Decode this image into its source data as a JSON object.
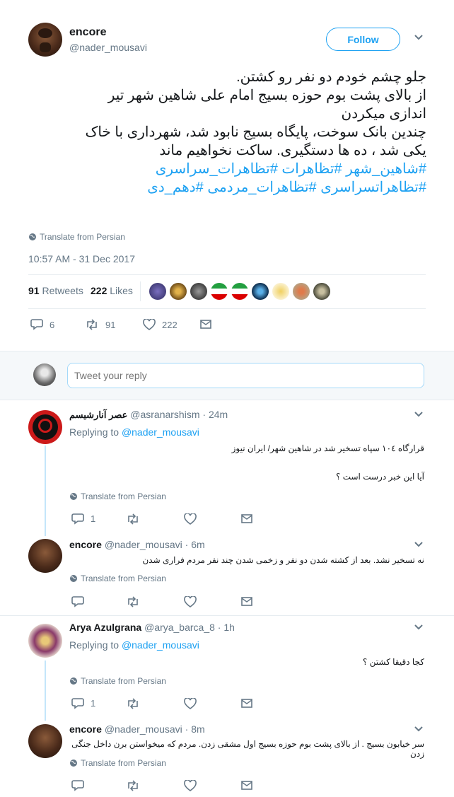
{
  "main_tweet": {
    "author_name": "encore",
    "author_handle": "@nader_mousavi",
    "follow_label": "Follow",
    "text_lines": [
      "جلو چشم خودم دو نفر رو کشتن.",
      "از بالای پشت بوم حوزه بسیج امام علی شاهین شهر تیر",
      "اندازی میکردن",
      "چندین بانک سوخت، پایگاه بسیج نابود شد، شهرداری با خاک",
      "یکی شد ، ده ها دستگیری. ساکت نخواهیم ماند"
    ],
    "hashtags_line1": "#شاهین_شهر #تظاهرات #تظاهرات_سراسری",
    "hashtags_line2": "#تظاهراتسراسری #تظاهرات_مردمی #دهم_دی",
    "translate_label": "Translate from Persian",
    "timestamp": "10:57 AM - 31 Dec 2017",
    "retweets_count": "91",
    "retweets_label": "Retweets",
    "likes_count": "222",
    "likes_label": "Likes",
    "replies": "6",
    "retweets": "91",
    "likes": "222"
  },
  "reply_box": {
    "placeholder": "Tweet your reply"
  },
  "replies": [
    {
      "name": "عصر آنارشیسم",
      "handle": "@asranarshism",
      "time": "· 24m",
      "replying_to_label": "Replying to",
      "replying_to": "@nader_mousavi",
      "line1": "قرارگاه ١٠٤ سپاه تسخیر شد در شاهین شهر/ ایران نیوز",
      "line2": "آیا این خبر درست است ؟",
      "translate_label": "Translate from Persian",
      "reply_count": "1",
      "retweet_count": "",
      "like_count": ""
    },
    {
      "name": "encore",
      "handle": "@nader_mousavi",
      "time": "· 6m",
      "line1": "نه تسخیر نشد. بعد از کشته شدن دو نفر و زخمی شدن چند نفر مردم فراری شدن",
      "translate_label": "Translate from Persian",
      "reply_count": "",
      "retweet_count": "",
      "like_count": ""
    },
    {
      "name": "Arya Azulgrana",
      "handle": "@arya_barca_8",
      "time": "· 1h",
      "replying_to_label": "Replying to",
      "replying_to": "@nader_mousavi",
      "line1": "کجا دقیقا کشتن ؟",
      "translate_label": "Translate from Persian",
      "reply_count": "1",
      "retweet_count": "",
      "like_count": ""
    },
    {
      "name": "encore",
      "handle": "@nader_mousavi",
      "time": "· 8m",
      "line1": "سر خیابون بسیج . از بالای پشت بوم حوزه بسیج اول مشقی زدن. مردم که میخواستن برن داخل جنگی زدن",
      "translate_label": "Translate from Persian",
      "reply_count": "",
      "retweet_count": "",
      "like_count": ""
    }
  ],
  "colors": {
    "link": "#1da1f2",
    "muted": "#657786",
    "thread_line": "#c4e6fa",
    "reply_area_bg": "#f5f8fa"
  },
  "icons": {
    "reply": "reply-icon",
    "retweet": "retweet-icon",
    "like": "heart-icon",
    "dm": "envelope-icon",
    "globe": "globe-icon",
    "chevron": "chevron-down-icon"
  }
}
